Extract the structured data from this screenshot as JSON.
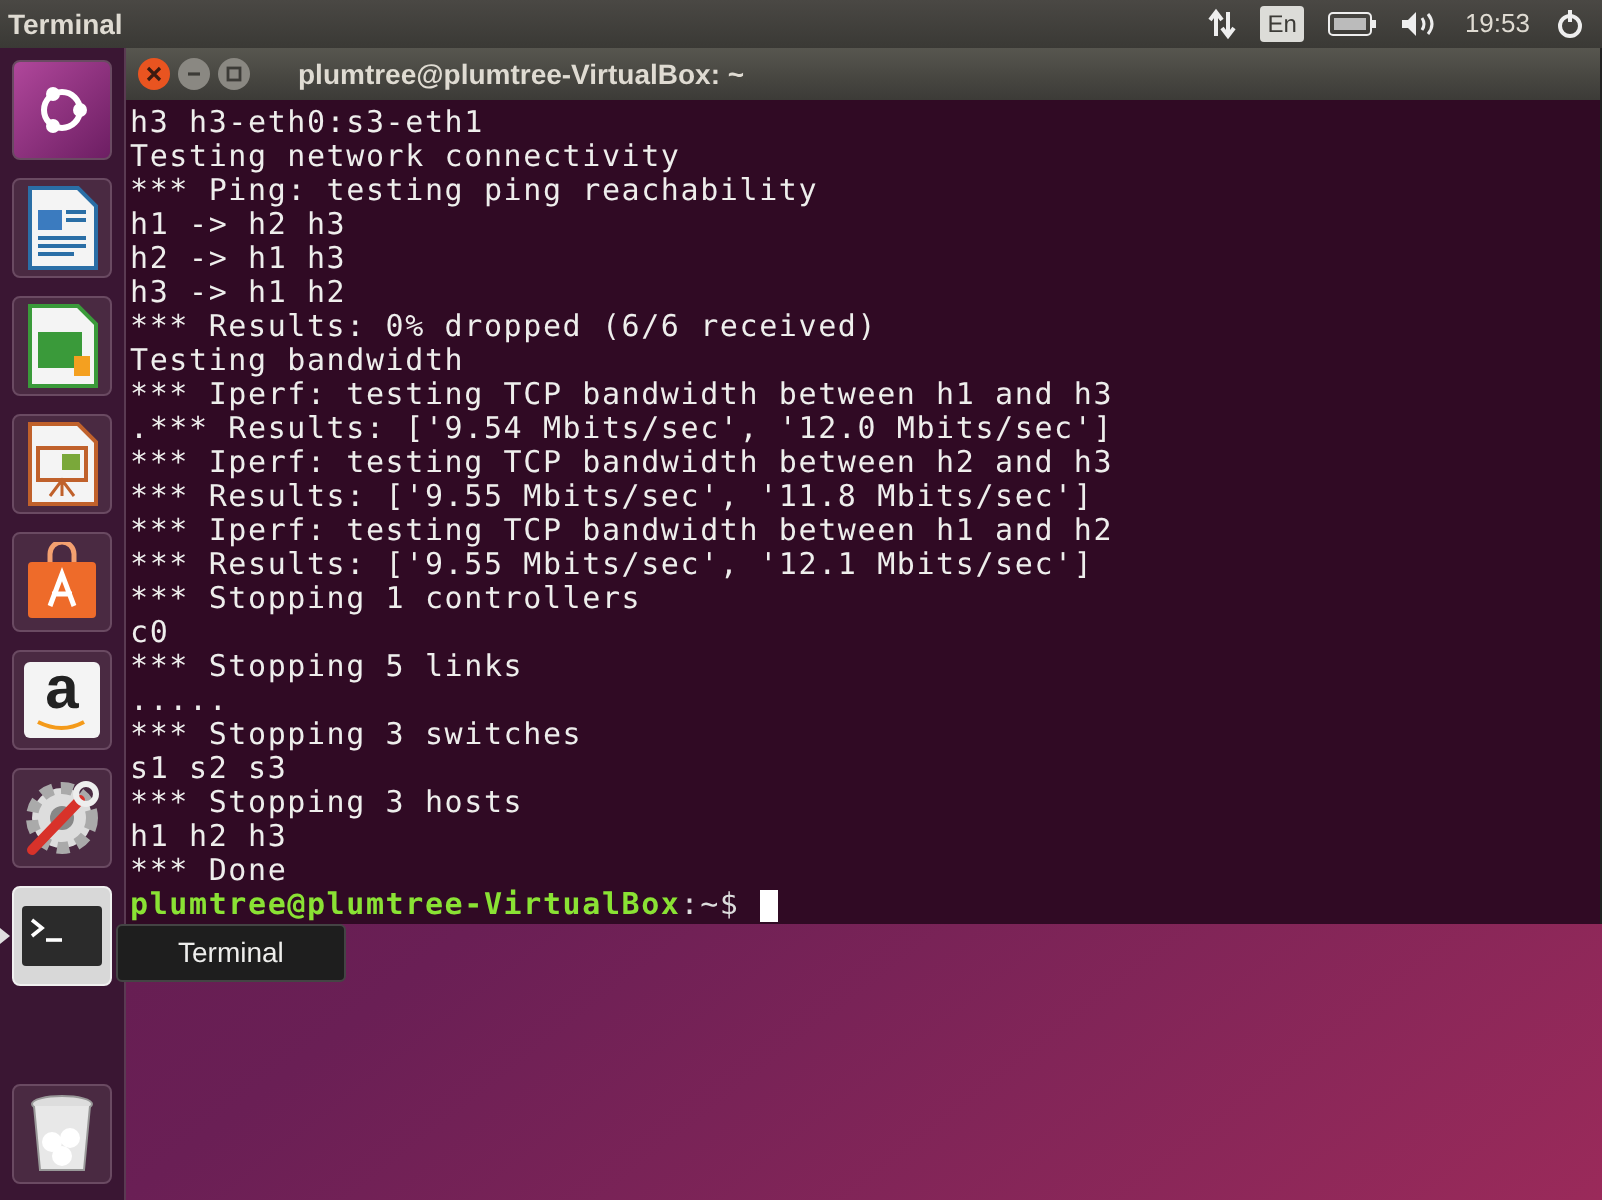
{
  "top_bar": {
    "app_title": "Terminal",
    "keyboard_layout": "En",
    "clock": "19:53"
  },
  "launcher": {
    "items": [
      {
        "kind": "dash",
        "active": false
      },
      {
        "kind": "writer",
        "active": false
      },
      {
        "kind": "calc",
        "active": false
      },
      {
        "kind": "impress",
        "active": false
      },
      {
        "kind": "software",
        "active": false
      },
      {
        "kind": "amazon",
        "glyph": "a",
        "active": false
      },
      {
        "kind": "settings",
        "active": false
      },
      {
        "kind": "terminal",
        "active": true
      }
    ],
    "trash": {
      "kind": "trash"
    },
    "tooltip": "Terminal"
  },
  "window": {
    "title": "plumtree@plumtree-VirtualBox: ~",
    "lines": [
      "h3 h3-eth0:s3-eth1",
      "Testing network connectivity",
      "*** Ping: testing ping reachability",
      "h1 -> h2 h3",
      "h2 -> h1 h3",
      "h3 -> h1 h2",
      "*** Results: 0% dropped (6/6 received)",
      "Testing bandwidth",
      "*** Iperf: testing TCP bandwidth between h1 and h3",
      ".*** Results: ['9.54 Mbits/sec', '12.0 Mbits/sec']",
      "*** Iperf: testing TCP bandwidth between h2 and h3",
      "*** Results: ['9.55 Mbits/sec', '11.8 Mbits/sec']",
      "*** Iperf: testing TCP bandwidth between h1 and h2",
      "*** Results: ['9.55 Mbits/sec', '12.1 Mbits/sec']",
      "*** Stopping 1 controllers",
      "c0",
      "*** Stopping 5 links",
      ".....",
      "*** Stopping 3 switches",
      "s1 s2 s3",
      "*** Stopping 3 hosts",
      "h1 h2 h3",
      "*** Done"
    ],
    "prompt": {
      "user_host": "plumtree@plumtree-VirtualBox",
      "path": ":~$"
    }
  }
}
